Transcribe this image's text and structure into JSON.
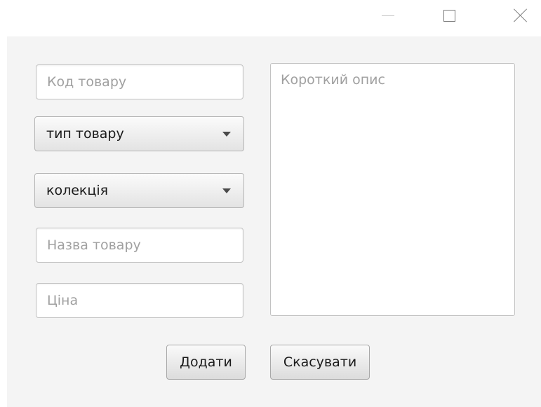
{
  "window": {
    "controls": {
      "minimize_icon": "minimize-icon",
      "maximize_icon": "maximize-icon",
      "close_icon": "close-icon"
    }
  },
  "form": {
    "code_field": {
      "placeholder": "Код товару",
      "value": ""
    },
    "type_combo": {
      "selected": "тип товару"
    },
    "collection_combo": {
      "selected": "колекція"
    },
    "name_field": {
      "placeholder": "Назва товару",
      "value": ""
    },
    "price_field": {
      "placeholder": "Ціна",
      "value": ""
    },
    "description_area": {
      "placeholder": "Короткий опис",
      "value": ""
    }
  },
  "actions": {
    "add_label": "Додати",
    "cancel_label": "Скасувати"
  },
  "colors": {
    "background": "#f4f4f4",
    "field_border": "#c2c2c2",
    "placeholder": "#a0a0a0"
  }
}
